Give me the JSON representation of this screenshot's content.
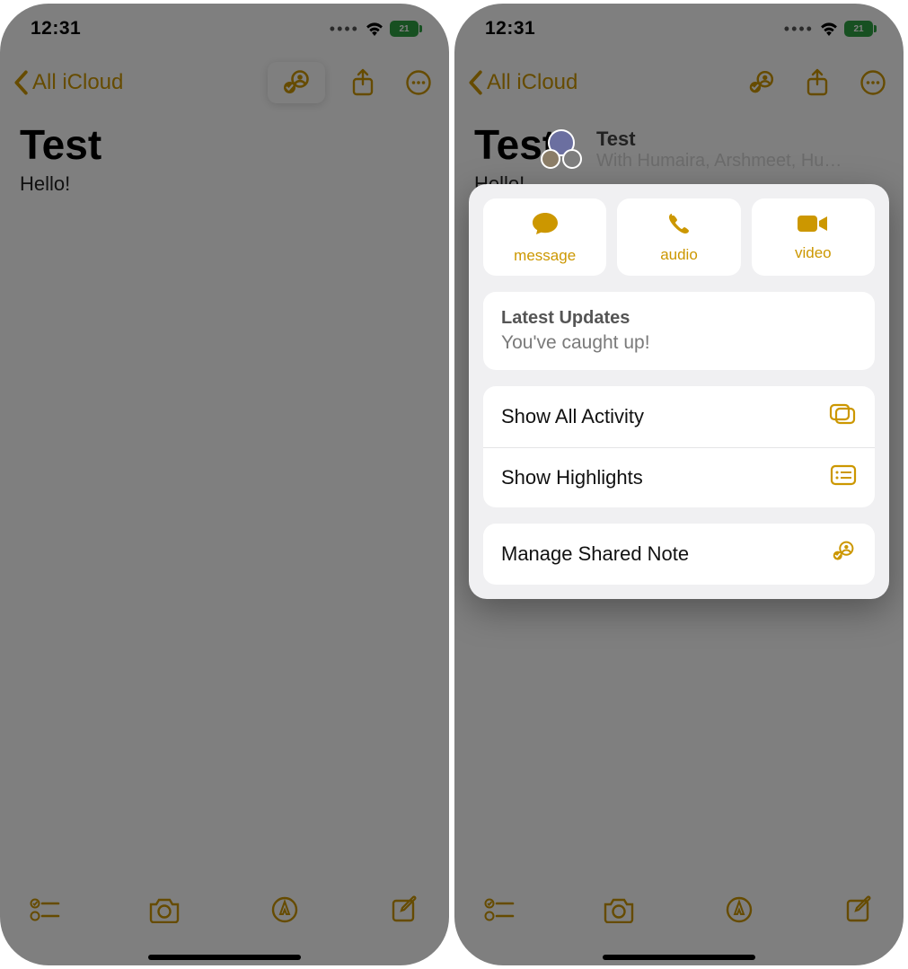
{
  "status": {
    "time": "12:31",
    "battery_label": "21"
  },
  "nav": {
    "back_label": "All iCloud"
  },
  "note": {
    "title": "Test",
    "body": "Hello!"
  },
  "popover": {
    "header_title": "Test",
    "header_sub": "With Humaira, Arshmeet, Hu…",
    "comm": {
      "message": "message",
      "audio": "audio",
      "video": "video"
    },
    "updates": {
      "title": "Latest Updates",
      "body": "You've caught up!"
    },
    "rows": {
      "activity": "Show All Activity",
      "highlights": "Show Highlights",
      "manage": "Manage Shared Note"
    }
  }
}
